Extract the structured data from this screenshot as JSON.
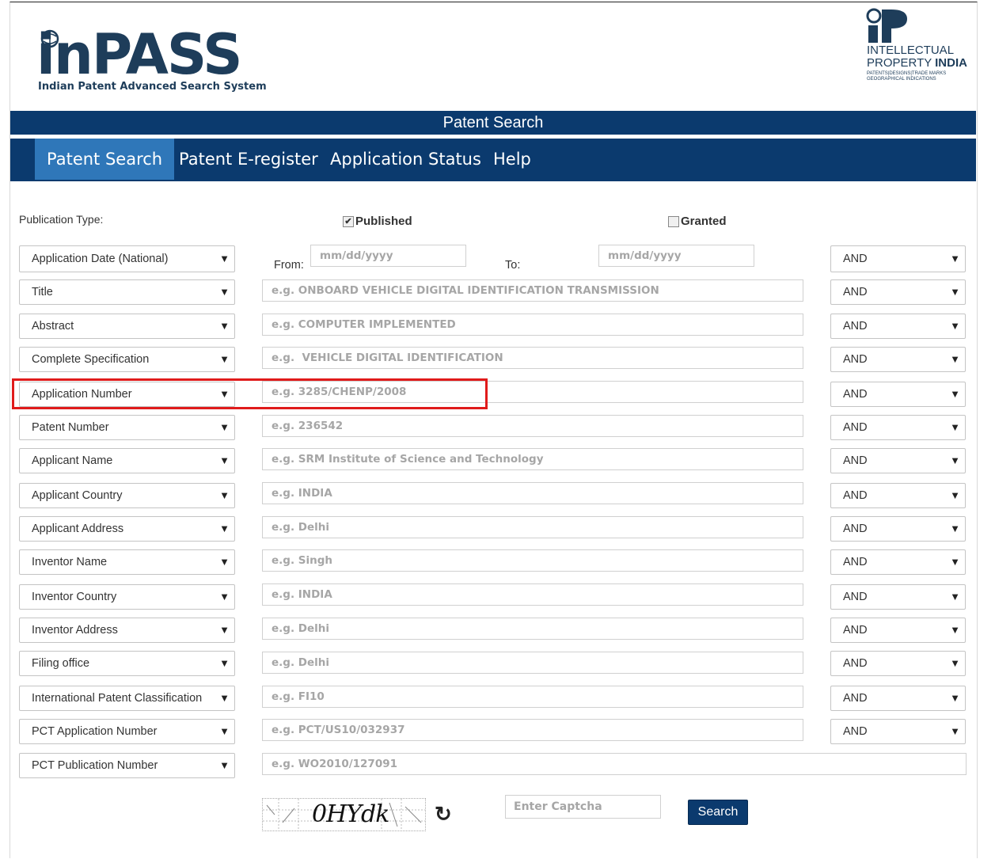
{
  "logo": {
    "brand": "inPASS",
    "subtitle": "Indian Patent Advanced Search System"
  },
  "ip_logo": {
    "line1": "INTELLECTUAL",
    "line2a": "PROPERTY ",
    "line2b": "INDIA",
    "line3": "PATENTS|DESIGNS|TRADE MARKS",
    "line4": "GEOGRAPHICAL INDICATIONS"
  },
  "title_bar": "Patent Search",
  "nav": [
    "Patent Search",
    "Patent E-register",
    "Application Status",
    "Help"
  ],
  "publication_type_label": "Publication Type:",
  "published": {
    "label": "Published",
    "checked": true
  },
  "granted": {
    "label": "Granted",
    "checked": false
  },
  "date_row": {
    "field": "Application Date (National)",
    "from_label": "From:",
    "to_label": "To:",
    "from_placeholder": "mm/dd/yyyy",
    "to_placeholder": "mm/dd/yyyy",
    "operator": "AND"
  },
  "rows": [
    {
      "field": "Title",
      "placeholder": "e.g. ONBOARD VEHICLE DIGITAL IDENTIFICATION TRANSMISSION",
      "operator": "AND"
    },
    {
      "field": "Abstract",
      "placeholder": "e.g. COMPUTER IMPLEMENTED",
      "operator": "AND"
    },
    {
      "field": "Complete Specification",
      "placeholder": "e.g.  VEHICLE DIGITAL IDENTIFICATION",
      "operator": "AND"
    },
    {
      "field": "Application Number",
      "placeholder": "e.g. 3285/CHENP/2008",
      "operator": "AND"
    },
    {
      "field": "Patent Number",
      "placeholder": "e.g. 236542",
      "operator": "AND"
    },
    {
      "field": "Applicant Name",
      "placeholder": "e.g. SRM Institute of Science and Technology",
      "operator": "AND"
    },
    {
      "field": "Applicant Country",
      "placeholder": "e.g. INDIA",
      "operator": "AND"
    },
    {
      "field": "Applicant Address",
      "placeholder": "e.g. Delhi",
      "operator": "AND"
    },
    {
      "field": "Inventor Name",
      "placeholder": "e.g. Singh",
      "operator": "AND"
    },
    {
      "field": "Inventor Country",
      "placeholder": "e.g. INDIA",
      "operator": "AND"
    },
    {
      "field": "Inventor Address",
      "placeholder": "e.g. Delhi",
      "operator": "AND"
    },
    {
      "field": "Filing office",
      "placeholder": "e.g. Delhi",
      "operator": "AND"
    },
    {
      "field": "International Patent Classification",
      "placeholder": "e.g. FI10",
      "operator": "AND"
    },
    {
      "field": "PCT Application Number",
      "placeholder": "e.g. PCT/US10/032937",
      "operator": "AND"
    },
    {
      "field": "PCT Publication Number",
      "placeholder": "e.g. WO2010/127091",
      "operator": null
    }
  ],
  "captcha": {
    "text": "0HYdk",
    "input_placeholder": "Enter Captcha",
    "refresh_icon": "refresh-icon"
  },
  "search_button": "Search",
  "colors": {
    "navy": "#0b3a6e",
    "active_tab": "#2f77b9",
    "highlight": "#e01b1b"
  }
}
